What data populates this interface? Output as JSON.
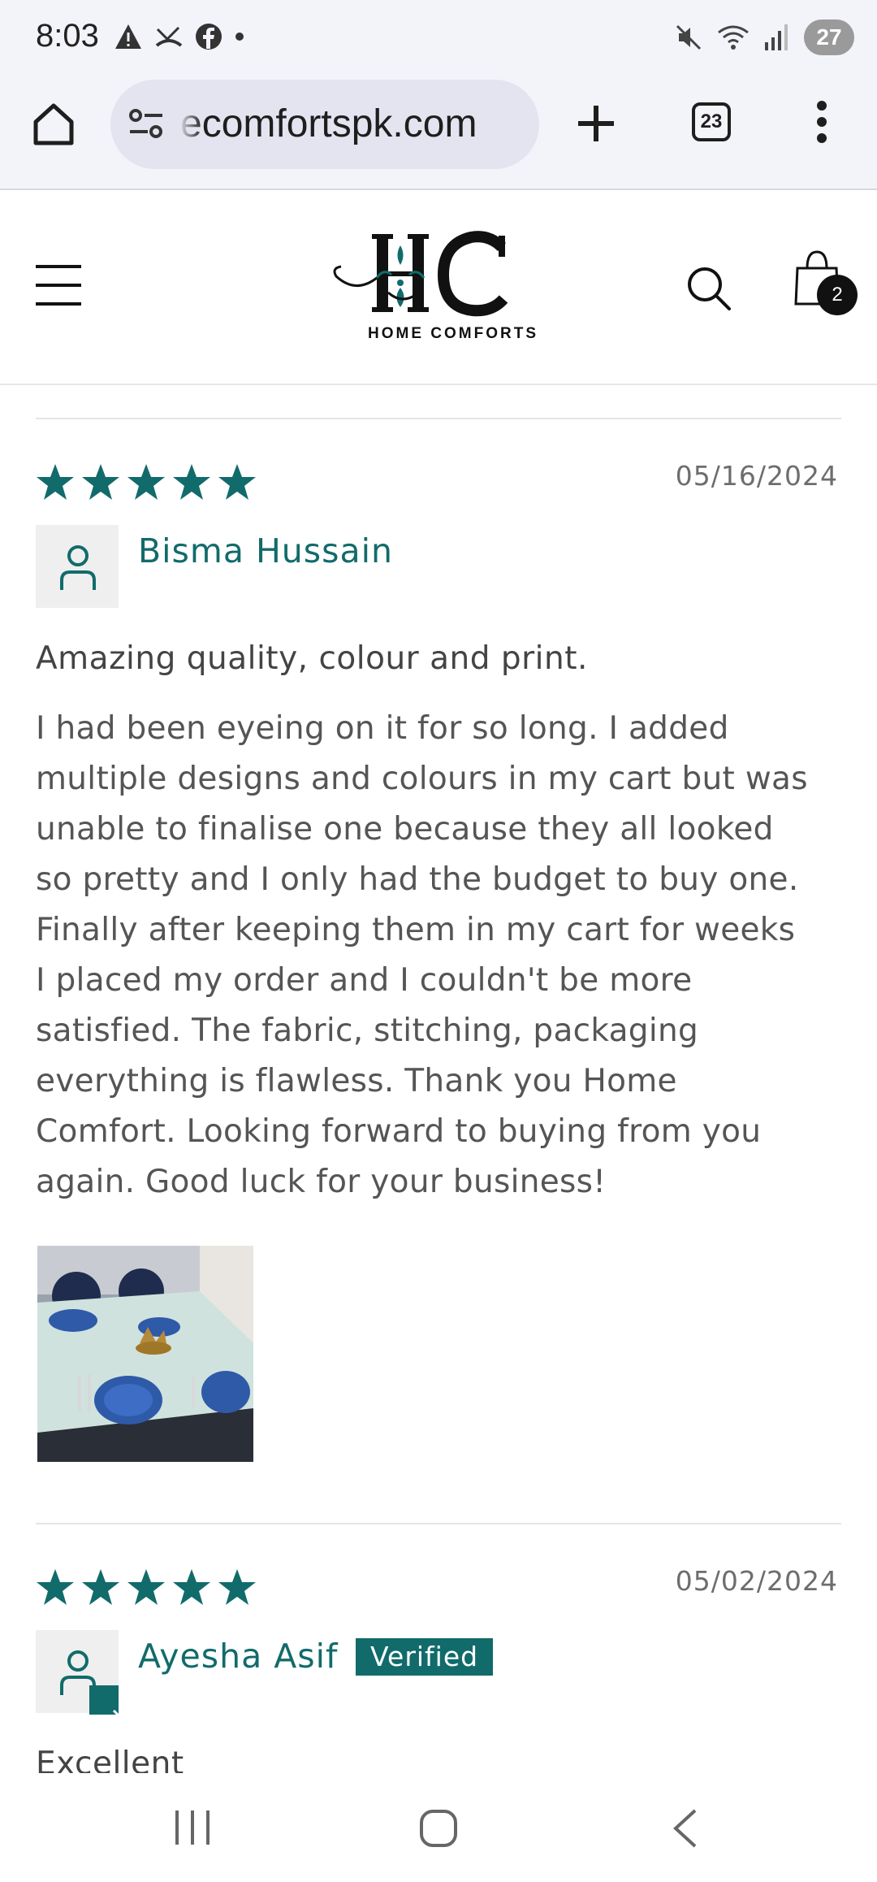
{
  "status_bar": {
    "time": "8:03",
    "battery": "27",
    "left_icons": [
      "alert-icon",
      "missed-call-icon",
      "facebook-icon",
      "dot-icon"
    ],
    "right_icons": [
      "mute-icon",
      "wifi-icon",
      "signal-icon",
      "battery-icon"
    ]
  },
  "browser": {
    "url": "ecomfortspk.com",
    "tab_count": "23"
  },
  "site": {
    "logo_mark": "HC",
    "logo_text": "HOME COMFORTS",
    "cart_count": "2",
    "brand_color": "#126b6b"
  },
  "reviews": [
    {
      "rating": 5,
      "date": "05/16/2024",
      "name": "Bisma Hussain",
      "title": "Amazing quality, colour and print.",
      "body_lines": [
        "I had been eyeing on it for so long. I added",
        "multiple designs and colours in my cart but was",
        "unable to finalise one because they all looked",
        "so pretty and I only had the budget to buy one.",
        "Finally after keeping them in my cart for weeks",
        "I placed my order and I couldn't be more",
        "satisfied. The fabric, stitching, packaging",
        "everything is flawless. Thank you Home",
        "Comfort. Looking forward to buying from you",
        "again. Good luck for your business!"
      ]
    },
    {
      "rating": 5,
      "date": "05/02/2024",
      "name": "Ayesha Asif",
      "verified_label": "Verified",
      "title": "Excellent"
    }
  ]
}
